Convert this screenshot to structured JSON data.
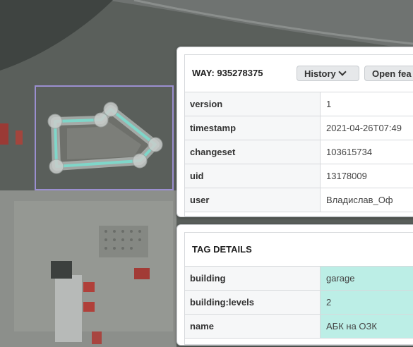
{
  "feature": {
    "title": "WAY: 935278375",
    "history_label": "History",
    "open_label": "Open fea",
    "rows": [
      {
        "key": "version",
        "value": "1"
      },
      {
        "key": "timestamp",
        "value": "2021-04-26T07:49"
      },
      {
        "key": "changeset",
        "value": "103615734"
      },
      {
        "key": "uid",
        "value": "13178009"
      },
      {
        "key": "user",
        "value": "Владислав_Оф"
      }
    ]
  },
  "tags": {
    "title": "TAG DETAILS",
    "rows": [
      {
        "key": "building",
        "value": "garage"
      },
      {
        "key": "building:levels",
        "value": "2"
      },
      {
        "key": "name",
        "value": "АБК на ОЗК"
      }
    ]
  },
  "colors": {
    "selection_box": "#9b8fd0",
    "way_outline": "#7fd6c9",
    "tag_highlight": "#bceee6"
  }
}
